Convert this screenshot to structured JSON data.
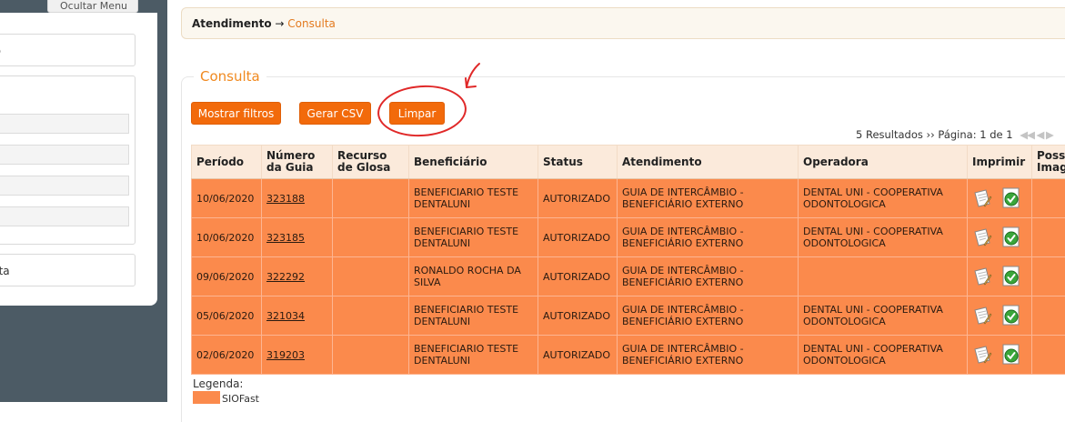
{
  "sidebar": {
    "hide_menu_label": "Ocultar Menu",
    "item_top_partial": "ro",
    "item_bottom_partial": "ista",
    "link_partial": "o"
  },
  "breadcrumb": {
    "root": "Atendimento",
    "arrow": "→",
    "current": "Consulta"
  },
  "section_title": "Consulta",
  "buttons": {
    "show_filters": "Mostrar filtros",
    "csv": "Gerar CSV",
    "clear": "Limpar"
  },
  "paging": {
    "results": "5 Resultados",
    "sep": "››",
    "page": "Página: 1 de 1",
    "icons": "◀◀ ◀ ▶"
  },
  "table": {
    "headers": [
      "Período",
      "Número da Guia",
      "Recurso de Glosa",
      "Beneficiário",
      "Status",
      "Atendimento",
      "Operadora",
      "Imprimir",
      "Poss Imag"
    ],
    "rows": [
      {
        "periodo": "10/06/2020",
        "guia": "323188",
        "recurso": "",
        "beneficiario": "BENEFICIARIO TESTE DENTALUNI",
        "status": "AUTORIZADO",
        "atendimento": "GUIA DE INTERCÂMBIO - BENEFICIÁRIO EXTERNO",
        "operadora": "DENTAL UNI - COOPERATIVA ODONTOLOGICA"
      },
      {
        "periodo": "10/06/2020",
        "guia": "323185",
        "recurso": "",
        "beneficiario": "BENEFICIARIO TESTE DENTALUNI",
        "status": "AUTORIZADO",
        "atendimento": "GUIA DE INTERCÂMBIO - BENEFICIÁRIO EXTERNO",
        "operadora": "DENTAL UNI - COOPERATIVA ODONTOLOGICA"
      },
      {
        "periodo": "09/06/2020",
        "guia": "322292",
        "recurso": "",
        "beneficiario": "RONALDO ROCHA DA SILVA",
        "status": "AUTORIZADO",
        "atendimento": "GUIA DE INTERCÂMBIO - BENEFICIÁRIO EXTERNO",
        "operadora": ""
      },
      {
        "periodo": "05/06/2020",
        "guia": "321034",
        "recurso": "",
        "beneficiario": "BENEFICIARIO TESTE DENTALUNI",
        "status": "AUTORIZADO",
        "atendimento": "GUIA DE INTERCÂMBIO - BENEFICIÁRIO EXTERNO",
        "operadora": "DENTAL UNI - COOPERATIVA ODONTOLOGICA"
      },
      {
        "periodo": "02/06/2020",
        "guia": "319203",
        "recurso": "",
        "beneficiario": "BENEFICIARIO TESTE DENTALUNI",
        "status": "AUTORIZADO",
        "atendimento": "GUIA DE INTERCÂMBIO - BENEFICIÁRIO EXTERNO",
        "operadora": "DENTAL UNI - COOPERATIVA ODONTOLOGICA"
      }
    ]
  },
  "legend": {
    "label": "Legenda:",
    "item": "SIOFast"
  },
  "colors": {
    "accent": "#f26a0b",
    "row": "#fb8a4c",
    "header": "#fbeadb",
    "annotation": "#e02828"
  },
  "icons": {
    "print": "print-document-icon",
    "approve": "approve-check-icon"
  }
}
